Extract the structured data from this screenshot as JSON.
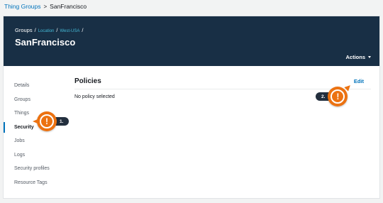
{
  "breadcrumb": {
    "parent": "Thing Groups",
    "separator": ">",
    "current": "SanFrancisco"
  },
  "header": {
    "crumbs": {
      "root": "Groups",
      "slash": "/",
      "level1": "Location",
      "level2": "West-USA"
    },
    "title": "SanFrancisco",
    "actions_label": "Actions"
  },
  "sidebar": {
    "items": [
      {
        "label": "Details"
      },
      {
        "label": "Groups"
      },
      {
        "label": "Things"
      },
      {
        "label": "Security",
        "active": true
      },
      {
        "label": "Jobs"
      },
      {
        "label": "Logs"
      },
      {
        "label": "Security profiles"
      },
      {
        "label": "Resource Tags"
      }
    ]
  },
  "main": {
    "panel_title": "Policies",
    "edit_label": "Edit",
    "empty_text": "No policy selected"
  },
  "callouts": {
    "step1": "1.",
    "step2": "2.",
    "marker_glyph": "!"
  },
  "colors": {
    "header_bg": "#182f45",
    "link": "#0073bb",
    "accent": "#ec7211"
  }
}
